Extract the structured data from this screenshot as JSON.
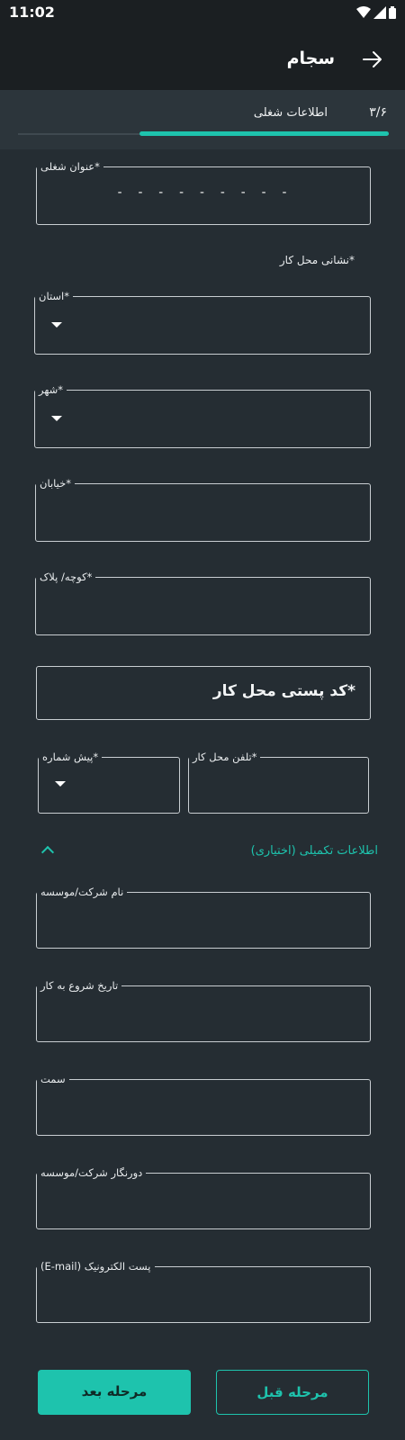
{
  "status": {
    "time": "11:02"
  },
  "appbar": {
    "title": "سجام"
  },
  "step": {
    "count": "۳/۶",
    "label": "اطلاعات شغلی",
    "progress": 0.67
  },
  "form": {
    "job_title": {
      "label": "*عنوان شغلی",
      "value": "- - - - - - - - -"
    },
    "address_section": "*نشانی محل کار",
    "province": {
      "label": "*استان",
      "value": ""
    },
    "city": {
      "label": "*شهر",
      "value": ""
    },
    "street": {
      "label": "*خیابان",
      "value": ""
    },
    "alley": {
      "label": "*کوچه/ پلاک",
      "value": ""
    },
    "postal_code": {
      "placeholder": "*کد پستی محل کار"
    },
    "work_phone": {
      "label": "*تلفن محل کار",
      "value": ""
    },
    "area_code": {
      "label": "*پیش شماره",
      "value": ""
    }
  },
  "optional": {
    "header": "اطلاعات تکمیلی (اختیاری)",
    "company_name": {
      "label": "نام شرکت/موسسه"
    },
    "start_date": {
      "label": "تاریخ شروع به کار"
    },
    "position": {
      "label": "سمت"
    },
    "company_fax": {
      "label": "دورنگار شرکت/موسسه"
    },
    "email": {
      "label": "پست الکترونیک (E-mail)"
    }
  },
  "buttons": {
    "next": "مرحله بعد",
    "prev": "مرحله قبل"
  },
  "colors": {
    "accent": "#1ec3ad",
    "background": "#252d33",
    "appbar": "#1b1f22"
  }
}
